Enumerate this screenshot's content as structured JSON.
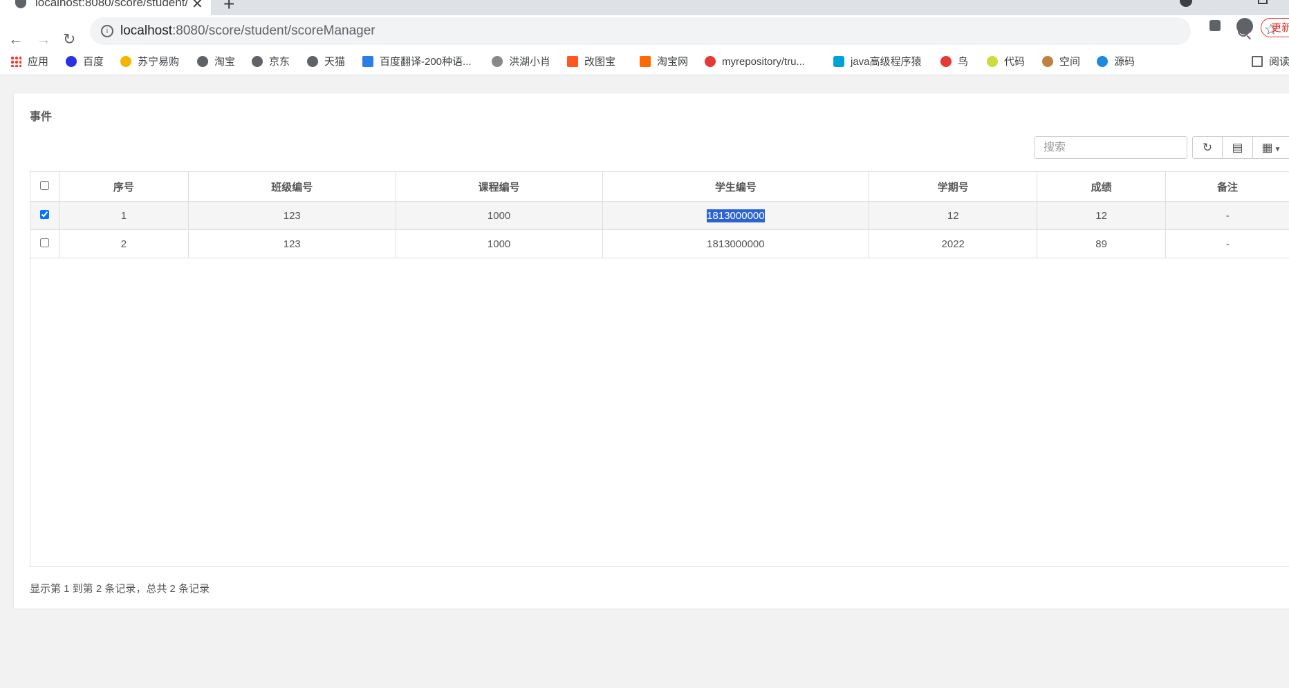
{
  "browser": {
    "tab_title": "localhost:8080/score/student/",
    "url_host": "localhost",
    "url_rest": ":8080/score/student/scoreManager",
    "update_label": "更新"
  },
  "bookmarks": [
    {
      "label": "应用",
      "color": "#ea4335"
    },
    {
      "label": "百度",
      "color": "#2932e1"
    },
    {
      "label": "苏宁易购",
      "color": "#f4b400"
    },
    {
      "label": "淘宝",
      "color": "#5f6368"
    },
    {
      "label": "京东",
      "color": "#5f6368"
    },
    {
      "label": "天猫",
      "color": "#5f6368"
    },
    {
      "label": "百度翻译-200种语...",
      "color": "#2b7de9"
    },
    {
      "label": "洪湖小肖",
      "color": "#888888"
    },
    {
      "label": "改图宝",
      "color": "#ff5722"
    },
    {
      "label": "淘宝网",
      "color": "#ff6a00"
    },
    {
      "label": "myrepository/tru...",
      "color": "#e53935"
    },
    {
      "label": "java高级程序猿",
      "color": "#00a1d6"
    },
    {
      "label": "鸟",
      "color": "#e53935"
    },
    {
      "label": "代码",
      "color": "#cddc39"
    },
    {
      "label": "空间",
      "color": "#c08040"
    },
    {
      "label": "源码",
      "color": "#1e88e5"
    },
    {
      "label": "阅读",
      "color": "#5f6368"
    }
  ],
  "panel": {
    "title": "事件",
    "search_placeholder": "搜索"
  },
  "table": {
    "columns": [
      "序号",
      "班级编号",
      "课程编号",
      "学生编号",
      "学期号",
      "成绩",
      "备注"
    ],
    "rows": [
      {
        "checked": true,
        "cells": [
          "1",
          "123",
          "1000",
          "1813000000",
          "12",
          "12",
          "-"
        ]
      },
      {
        "checked": false,
        "cells": [
          "2",
          "123",
          "1000",
          "1813000000",
          "2022",
          "89",
          "-"
        ]
      }
    ]
  },
  "footer": {
    "info": "显示第 1 到第 2 条记录，总共 2 条记录"
  }
}
